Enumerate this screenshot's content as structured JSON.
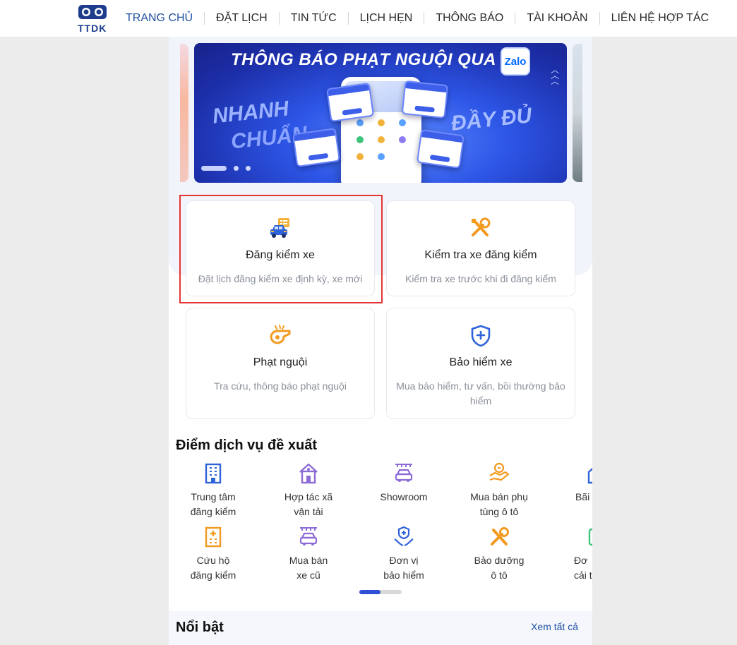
{
  "header": {
    "logo_text": "TTDK",
    "nav": [
      {
        "label": "TRANG CHỦ",
        "active": true
      },
      {
        "label": "ĐẶT LỊCH"
      },
      {
        "label": "TIN TỨC"
      },
      {
        "label": "LỊCH HẸN"
      },
      {
        "label": "THÔNG BÁO"
      },
      {
        "label": "TÀI KHOẢN"
      },
      {
        "label": "LIÊN HỆ HỢP TÁC"
      }
    ]
  },
  "banner": {
    "title": "THÔNG BÁO PHẠT NGUỘI QUA",
    "badge": "Zalo",
    "slogan1": "NHANH",
    "slogan2": "CHUẨN",
    "slogan3": "ĐẦY ĐỦ",
    "slide_count": 3,
    "active_slide": 1
  },
  "services": [
    {
      "title": "Đăng kiểm xe",
      "desc": "Đặt lịch đăng kiểm xe định kỳ, xe mới",
      "icon": "car-registration-icon",
      "highlighted": true
    },
    {
      "title": "Kiểm tra xe đăng kiểm",
      "desc": "Kiểm tra xe trước khi đi đăng kiểm",
      "icon": "tools-icon"
    },
    {
      "title": "Phạt nguội",
      "desc": "Tra cứu, thông báo phạt nguội",
      "icon": "whistle-icon"
    },
    {
      "title": "Bảo hiểm xe",
      "desc": "Mua bảo hiểm, tư vấn, bồi thường bảo hiểm",
      "icon": "shield-plus-icon"
    }
  ],
  "suggested": {
    "title": "Điểm dịch vụ đề xuất",
    "row1": [
      {
        "label": "Trung tâm đăng kiểm",
        "icon": "building-icon"
      },
      {
        "label": "Hợp tác xã vận tải",
        "icon": "house-icon"
      },
      {
        "label": "Showroom",
        "icon": "showroom-car-icon"
      },
      {
        "label": "Mua bán phụ tùng ô tô",
        "icon": "handshake-icon"
      },
      {
        "label": "Bãi",
        "icon": "parking-icon"
      }
    ],
    "row2": [
      {
        "label": "Cứu hộ đăng kiểm",
        "icon": "rescue-building-icon"
      },
      {
        "label": "Mua bán xe cũ",
        "icon": "used-car-icon"
      },
      {
        "label": "Đơn vị bảo hiểm",
        "icon": "insurance-hands-icon"
      },
      {
        "label": "Bảo dưỡng ô tô",
        "icon": "wrench-icon"
      },
      {
        "label": "Đơ cải t",
        "icon": "modify-car-icon"
      }
    ],
    "pager": {
      "pages": 2,
      "active": 1
    }
  },
  "featured": {
    "title": "Nổi bật",
    "see_all": "Xem tất cả"
  },
  "colors": {
    "accent": "#1f4fa1",
    "icon_blue": "#2f63d8",
    "icon_orange": "#f29a1f",
    "icon_purple": "#8c6bd6",
    "highlight": "#e53535"
  }
}
